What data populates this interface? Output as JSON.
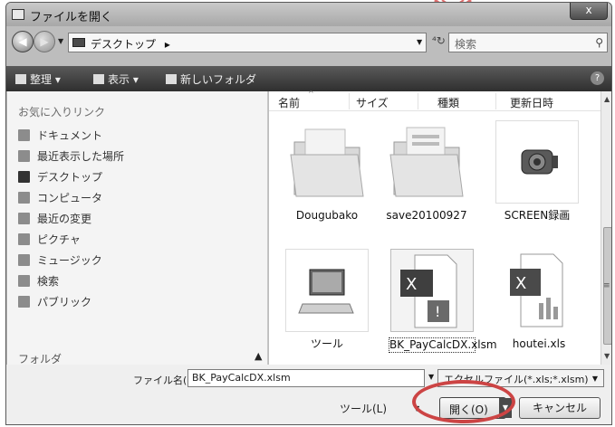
{
  "window": {
    "title": "ファイルを開く",
    "close_glyph": "x"
  },
  "address": {
    "location": "デスクトップ",
    "crumb_arrow": "▸",
    "search_placeholder": "検索"
  },
  "toolbar": {
    "organize": "整理",
    "view": "表示",
    "new_folder": "新しいフォルダ",
    "help": "?"
  },
  "nav": {
    "favorites_title": "お気に入りリンク",
    "items": [
      {
        "label": "ドキュメント"
      },
      {
        "label": "最近表示した場所"
      },
      {
        "label": "デスクトップ"
      },
      {
        "label": "コンピュータ"
      },
      {
        "label": "最近の変更"
      },
      {
        "label": "ピクチャ"
      },
      {
        "label": "ミュージック"
      },
      {
        "label": "検索"
      },
      {
        "label": "パブリック"
      }
    ],
    "folder_label": "フォルダ"
  },
  "columns": {
    "name": "名前",
    "size": "サイズ",
    "type": "種類",
    "modified": "更新日時"
  },
  "files": [
    {
      "name": "Dougubako",
      "kind": "folder"
    },
    {
      "name": "save20100927",
      "kind": "folder"
    },
    {
      "name": "SCREEN録画",
      "kind": "camera"
    },
    {
      "name": "ツール",
      "kind": "tool"
    },
    {
      "name": "BK_PayCalcDX.xlsm",
      "kind": "excel-macro",
      "selected": true
    },
    {
      "name": "houtei.xls",
      "kind": "excel"
    }
  ],
  "bottom": {
    "filename_label": "ファイル名(N):",
    "filename_value": "BK_PayCalcDX.xlsm",
    "filetype_value": "エクセルファイル(*.xls;*.xlsm)",
    "tools_label": "ツール(L)",
    "open_label": "開く(O)",
    "cancel_label": "キャンセル"
  },
  "colors": {
    "toolbar_bg": "#2f2f2f",
    "highlight_ring": "#cc4444",
    "decoration": "#e07070"
  }
}
